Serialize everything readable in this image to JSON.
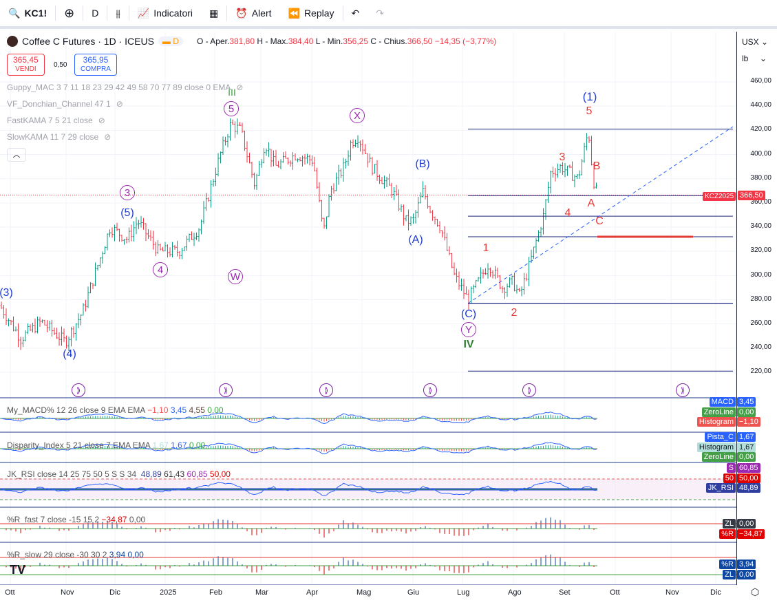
{
  "toolbar": {
    "symbol": "KC1!",
    "interval": "D",
    "indicators": "Indicatori",
    "alert": "Alert",
    "replay": "Replay"
  },
  "legend": {
    "title": "Coffee C Futures · 1D · ICEUS",
    "badge": "D",
    "o_label": "O - Aper.",
    "o": "381,80",
    "h_label": "H - Max.",
    "h": "384,40",
    "l_label": "L - Min.",
    "l": "356,25",
    "c_label": "C - Chius.",
    "c": "366,50",
    "change": "−14,35 (−3,77%)"
  },
  "trade": {
    "sell_price": "365,45",
    "sell_label": "VENDI",
    "spread": "0,50",
    "buy_price": "365,95",
    "buy_label": "COMPRA"
  },
  "indicators": [
    "Guppy_MAC 3 7 11 18 23 29 42 49 58 70 77 89 close 0 EMA",
    "VF_Donchian_Channel 47 1",
    "FastKAMA 7 5 21 close",
    "SlowKAMA 11 7 29 close"
  ],
  "axis": {
    "currency": "USX",
    "unit": "lb",
    "prices": [
      "460,00",
      "440,00",
      "420,00",
      "400,00",
      "380,00",
      "360,00",
      "340,00",
      "320,00",
      "300,00",
      "280,00",
      "260,00",
      "240,00",
      "220,00"
    ],
    "last_symbol": "KCZ2025",
    "last_price": "366,50"
  },
  "waves": {
    "iii": "III",
    "c5": "5",
    "cx": "X",
    "c3": "3",
    "p5": "(5)",
    "c4": "4",
    "cw": "W",
    "p3": "(3)",
    "p4": "(4)",
    "pB": "(B)",
    "pA": "(A)",
    "pC": "(C)",
    "cy": "Y",
    "iv": "IV",
    "w1": "1",
    "w2": "2",
    "w3": "3",
    "w4": "4",
    "w5": "5",
    "p1": "(1)",
    "wA": "A",
    "wB": "B",
    "wC": "C"
  },
  "panes": {
    "macd": {
      "title": "My_MACD% 12 26 close 9 EMA EMA",
      "v1": "−1,10",
      "v2": "3,45",
      "v3": "4,55",
      "v4": "0,00",
      "tags": [
        {
          "l": "MACD",
          "v": "3,45",
          "c": "#2962ff"
        },
        {
          "l": "ZeroLine",
          "v": "0,00",
          "c": "#43a047"
        },
        {
          "l": "Histogram",
          "v": "−1,10",
          "c": "#ef5350"
        }
      ]
    },
    "disp": {
      "title": "Disparity_Index 5 21 close 7 EMA EMA",
      "v1": "1,67",
      "v2": "1,67",
      "v3": "0,00",
      "tags": [
        {
          "l": "Pista_C",
          "v": "1,67",
          "c": "#2962ff"
        },
        {
          "l": "Histogram",
          "v": "1,67",
          "c": "#b2dfdb"
        },
        {
          "l": "ZeroLine",
          "v": "0,00",
          "c": "#43a047"
        }
      ]
    },
    "rsi": {
      "title": "JK_RSI close 14 25 75 50 5 S S 34",
      "v1": "48,89",
      "v2": "61,43",
      "v3": "60,85",
      "v4": "50,00",
      "tags": [
        {
          "l": "S",
          "v": "60,85",
          "c": "#9c27b0"
        },
        {
          "l": "50",
          "v": "50,00",
          "c": "#e00000"
        },
        {
          "l": "JK_RSI",
          "v": "48,89",
          "c": "#303f9f"
        }
      ]
    },
    "rfast": {
      "title": "%R_fast 7 close -15 15 2",
      "v1": "−34,87",
      "v2": "0,00",
      "tags": [
        {
          "l": "ZL",
          "v": "0,00",
          "c": "#363a45"
        },
        {
          "l": "%R",
          "v": "−34,87",
          "c": "#e00000"
        }
      ]
    },
    "rslow": {
      "title": "%R_slow 29 close -30 30 2",
      "v1": "3,94",
      "v2": "0,00",
      "tags": [
        {
          "l": "%R",
          "v": "3,94",
          "c": "#0d47a1"
        },
        {
          "l": "ZL",
          "v": "0,00",
          "c": "#0d47a1"
        }
      ]
    }
  },
  "time_axis": [
    "Ott",
    "Nov",
    "Dic",
    "2025",
    "Feb",
    "Mar",
    "Apr",
    "Mag",
    "Giu",
    "Lug",
    "Ago",
    "Set",
    "Ott",
    "Nov",
    "Dic"
  ],
  "price_path": [
    [
      0,
      275
    ],
    [
      30,
      248
    ],
    [
      60,
      262
    ],
    [
      95,
      245
    ],
    [
      120,
      270
    ],
    [
      160,
      340
    ],
    [
      185,
      330
    ],
    [
      200,
      345
    ],
    [
      230,
      320
    ],
    [
      260,
      320
    ],
    [
      290,
      340
    ],
    [
      320,
      400
    ],
    [
      335,
      425
    ],
    [
      350,
      420
    ],
    [
      370,
      375
    ],
    [
      385,
      410
    ],
    [
      400,
      390
    ],
    [
      430,
      400
    ],
    [
      455,
      395
    ],
    [
      470,
      335
    ],
    [
      480,
      370
    ],
    [
      500,
      390
    ],
    [
      510,
      410
    ],
    [
      520,
      415
    ],
    [
      540,
      390
    ],
    [
      570,
      370
    ],
    [
      590,
      345
    ],
    [
      600,
      345
    ],
    [
      615,
      370
    ],
    [
      625,
      355
    ],
    [
      640,
      340
    ],
    [
      660,
      300
    ],
    [
      680,
      280
    ],
    [
      700,
      300
    ],
    [
      710,
      310
    ],
    [
      730,
      290
    ],
    [
      745,
      295
    ],
    [
      755,
      283
    ],
    [
      770,
      310
    ],
    [
      790,
      350
    ],
    [
      800,
      385
    ],
    [
      815,
      390
    ],
    [
      840,
      380
    ],
    [
      855,
      420
    ],
    [
      862,
      380
    ],
    [
      868,
      366
    ]
  ],
  "levels": [
    421,
    366,
    349,
    332,
    277,
    221
  ]
}
